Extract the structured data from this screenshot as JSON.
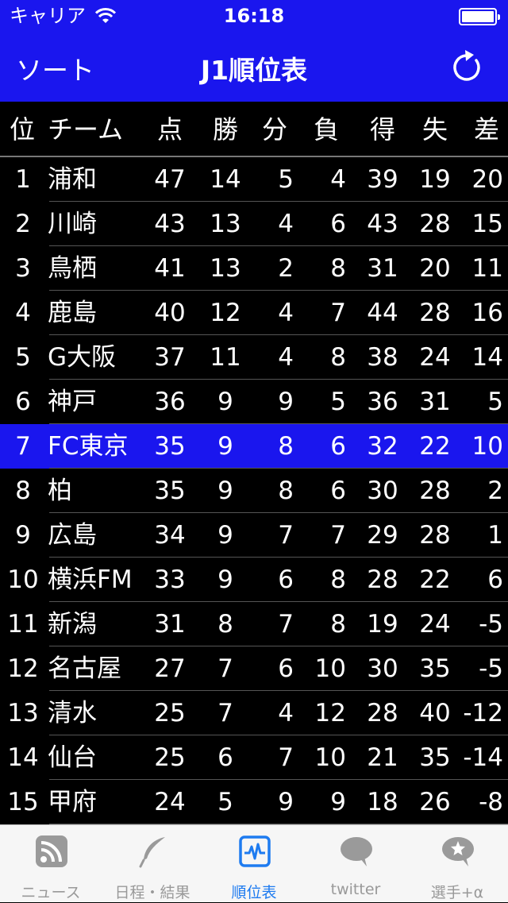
{
  "status": {
    "carrier": "キャリア",
    "time": "16:18"
  },
  "nav": {
    "sort": "ソート",
    "title": "J1順位表"
  },
  "table": {
    "headers": {
      "pos": "位",
      "team": "チーム",
      "pts": "点",
      "w": "勝",
      "d": "分",
      "l": "負",
      "gf": "得",
      "ga": "失",
      "gd": "差"
    },
    "highlight_row": 6,
    "rows": [
      {
        "pos": "1",
        "team": "浦和",
        "pts": "47",
        "w": "14",
        "d": "5",
        "l": "4",
        "gf": "39",
        "ga": "19",
        "gd": "20"
      },
      {
        "pos": "2",
        "team": "川崎",
        "pts": "43",
        "w": "13",
        "d": "4",
        "l": "6",
        "gf": "43",
        "ga": "28",
        "gd": "15"
      },
      {
        "pos": "3",
        "team": "鳥栖",
        "pts": "41",
        "w": "13",
        "d": "2",
        "l": "8",
        "gf": "31",
        "ga": "20",
        "gd": "11"
      },
      {
        "pos": "4",
        "team": "鹿島",
        "pts": "40",
        "w": "12",
        "d": "4",
        "l": "7",
        "gf": "44",
        "ga": "28",
        "gd": "16"
      },
      {
        "pos": "5",
        "team": "G大阪",
        "pts": "37",
        "w": "11",
        "d": "4",
        "l": "8",
        "gf": "38",
        "ga": "24",
        "gd": "14"
      },
      {
        "pos": "6",
        "team": "神戸",
        "pts": "36",
        "w": "9",
        "d": "9",
        "l": "5",
        "gf": "36",
        "ga": "31",
        "gd": "5"
      },
      {
        "pos": "7",
        "team": "FC東京",
        "pts": "35",
        "w": "9",
        "d": "8",
        "l": "6",
        "gf": "32",
        "ga": "22",
        "gd": "10"
      },
      {
        "pos": "8",
        "team": "柏",
        "pts": "35",
        "w": "9",
        "d": "8",
        "l": "6",
        "gf": "30",
        "ga": "28",
        "gd": "2"
      },
      {
        "pos": "9",
        "team": "広島",
        "pts": "34",
        "w": "9",
        "d": "7",
        "l": "7",
        "gf": "29",
        "ga": "28",
        "gd": "1"
      },
      {
        "pos": "10",
        "team": "横浜FM",
        "pts": "33",
        "w": "9",
        "d": "6",
        "l": "8",
        "gf": "28",
        "ga": "22",
        "gd": "6"
      },
      {
        "pos": "11",
        "team": "新潟",
        "pts": "31",
        "w": "8",
        "d": "7",
        "l": "8",
        "gf": "19",
        "ga": "24",
        "gd": "-5"
      },
      {
        "pos": "12",
        "team": "名古屋",
        "pts": "27",
        "w": "7",
        "d": "6",
        "l": "10",
        "gf": "30",
        "ga": "35",
        "gd": "-5"
      },
      {
        "pos": "13",
        "team": "清水",
        "pts": "25",
        "w": "7",
        "d": "4",
        "l": "12",
        "gf": "28",
        "ga": "40",
        "gd": "-12"
      },
      {
        "pos": "14",
        "team": "仙台",
        "pts": "25",
        "w": "6",
        "d": "7",
        "l": "10",
        "gf": "21",
        "ga": "35",
        "gd": "-14"
      },
      {
        "pos": "15",
        "team": "甲府",
        "pts": "24",
        "w": "5",
        "d": "9",
        "l": "9",
        "gf": "18",
        "ga": "26",
        "gd": "-8"
      }
    ]
  },
  "tabs": [
    {
      "label": "ニュース",
      "icon": "rss-icon"
    },
    {
      "label": "日程・結果",
      "icon": "feather-icon"
    },
    {
      "label": "順位表",
      "icon": "activity-monitor-icon"
    },
    {
      "label": "twitter",
      "icon": "speech-bubble-icon"
    },
    {
      "label": "選手+α",
      "icon": "star-bubble-icon"
    }
  ],
  "active_tab": 2,
  "colors": {
    "nav_blue": "#1a16ee",
    "tab_active": "#1e7bf0",
    "tab_inactive": "#999999"
  }
}
